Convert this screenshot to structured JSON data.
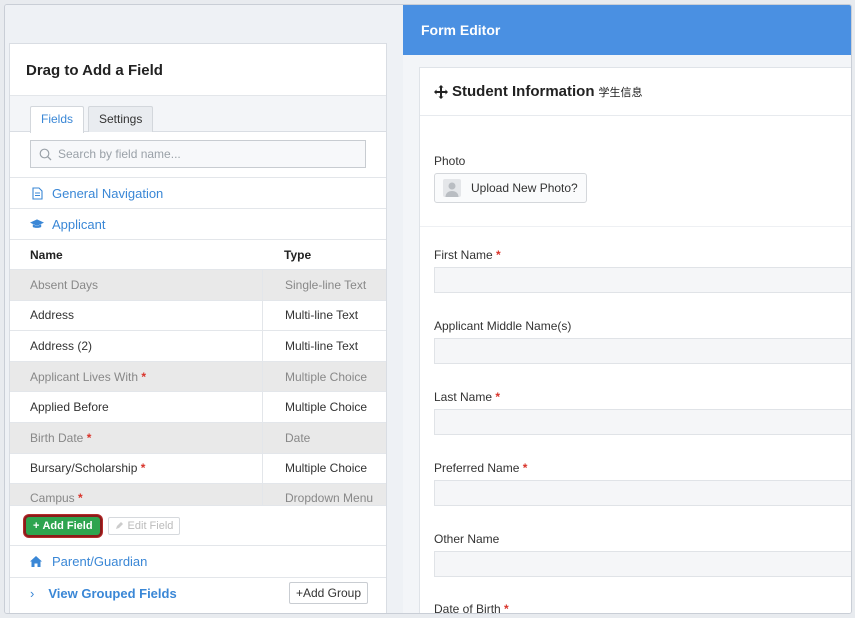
{
  "left": {
    "title": "Drag to Add a Field",
    "tabs": [
      {
        "label": "Fields",
        "active": true
      },
      {
        "label": "Settings",
        "active": false
      }
    ],
    "search": {
      "placeholder": "Search by field name..."
    },
    "nav": {
      "general": "General Navigation",
      "applicant": "Applicant"
    },
    "table": {
      "headers": {
        "name": "Name",
        "type": "Type"
      },
      "rows": [
        {
          "name": "Absent Days",
          "required": "",
          "type": "Single-line Text",
          "used": true
        },
        {
          "name": "Address",
          "required": "",
          "type": "Multi-line Text",
          "used": false
        },
        {
          "name": "Address (2)",
          "required": "",
          "type": "Multi-line Text",
          "used": false
        },
        {
          "name": "Applicant Lives With",
          "required": "*",
          "type": "Multiple Choice",
          "used": true
        },
        {
          "name": "Applied Before",
          "required": "",
          "type": "Multiple Choice",
          "used": false
        },
        {
          "name": "Birth Date",
          "required": "*",
          "type": "Date",
          "used": true
        },
        {
          "name": "Bursary/Scholarship",
          "required": "*",
          "type": "Multiple Choice",
          "used": false
        },
        {
          "name": "Campus",
          "required": "*",
          "type": "Dropdown Menu",
          "used": true
        }
      ]
    },
    "buttons": {
      "add_field": "Add Field",
      "edit_field": "Edit Field"
    },
    "parent": "Parent/Guardian",
    "grouped": {
      "label": "View Grouped Fields",
      "add_group": "Add Group"
    }
  },
  "right": {
    "bar_title": "Form Editor",
    "section": {
      "title": "Student Information",
      "subtitle": "学生信息"
    },
    "photo": {
      "label": "Photo",
      "button": "Upload New Photo?"
    },
    "fields": [
      {
        "label": "First Name",
        "required": "*"
      },
      {
        "label": "Applicant Middle Name(s)",
        "required": ""
      },
      {
        "label": "Last Name",
        "required": "*"
      },
      {
        "label": "Preferred Name",
        "required": "*"
      },
      {
        "label": "Other Name",
        "required": ""
      },
      {
        "label": "Date of Birth",
        "required": "*"
      }
    ]
  },
  "colors": {
    "accent": "#3a87d6",
    "header_bar": "#4a90e2",
    "add_button": "#2ea44f",
    "required": "#d9342b"
  }
}
